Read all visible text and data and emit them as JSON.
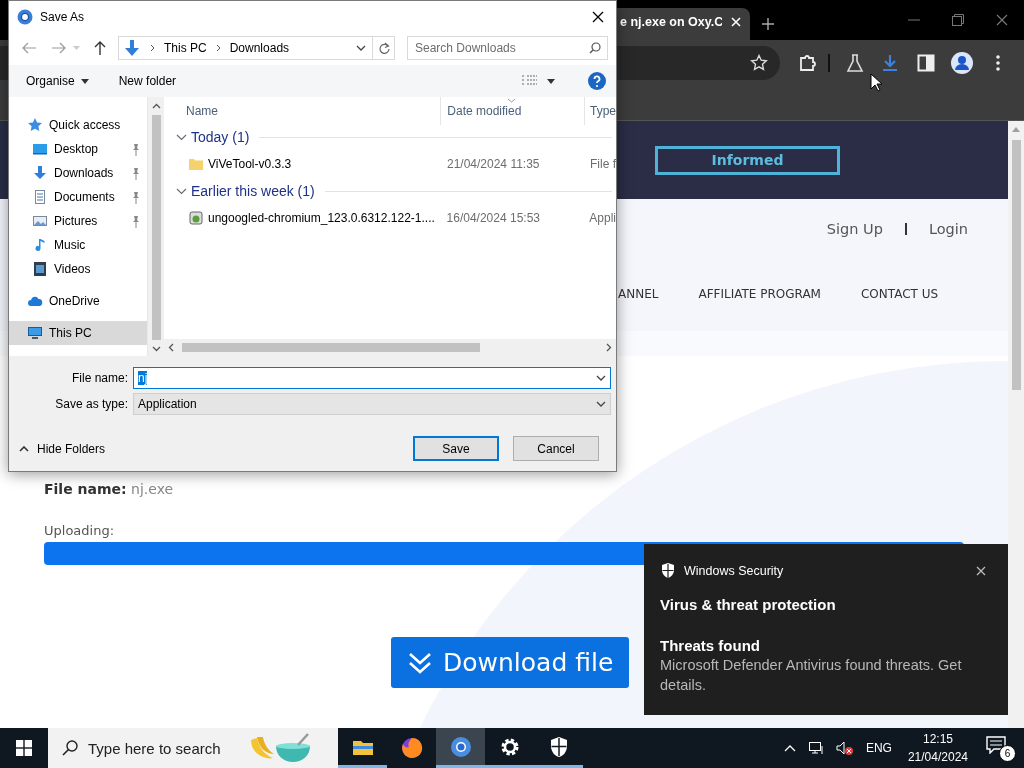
{
  "browser": {
    "tab_title": "e nj.exe on Oxy.C"
  },
  "page": {
    "header_button": "Informed",
    "auth_links": [
      "Sign Up",
      "Login"
    ],
    "nav": [
      "ANNEL",
      "AFFILIATE PROGRAM",
      "CONTACT US"
    ],
    "file_label": "File name:",
    "file_value": "nj.exe",
    "upload_label": "Uploading:",
    "upload": {
      "level": 1
    },
    "download_button": "Download file"
  },
  "dialog": {
    "title": "Save As",
    "path": [
      "This PC",
      "Downloads"
    ],
    "search": {
      "placeholder": "Search Downloads"
    },
    "toolbar": [
      {
        "label": "Organise",
        "kind": "menu"
      },
      {
        "label": "New folder",
        "kind": "button"
      }
    ],
    "nav_items": [
      {
        "label": "Quick access",
        "kind": "star",
        "selected": false,
        "children": [
          {
            "label": "Desktop",
            "kind": "desktop",
            "pinned": true,
            "selected": false
          },
          {
            "label": "Downloads",
            "kind": "download",
            "pinned": true,
            "selected": false
          },
          {
            "label": "Documents",
            "kind": "document",
            "pinned": true,
            "selected": false
          },
          {
            "label": "Pictures",
            "kind": "picture",
            "pinned": true,
            "selected": false
          },
          {
            "label": "Music",
            "kind": "music",
            "pinned": false,
            "selected": false
          },
          {
            "label": "Videos",
            "kind": "video",
            "pinned": false,
            "selected": false
          }
        ]
      },
      {
        "label": "OneDrive",
        "kind": "cloud",
        "selected": false
      },
      {
        "label": "This PC",
        "kind": "computer",
        "selected": true
      }
    ],
    "columns": [
      "Name",
      "Date modified",
      "Type"
    ],
    "groups": [
      {
        "label": "Today (1)",
        "files": [
          {
            "name": "ViVeTool-v0.3.3",
            "date": "21/04/2024 11:35",
            "type": "File f",
            "kind": "folder"
          }
        ]
      },
      {
        "label": "Earlier this week (1)",
        "files": [
          {
            "name": "ungoogled-chromium_123.0.6312.122-1....",
            "date": "16/04/2024 15:53",
            "type": "Appli",
            "kind": "app"
          }
        ]
      }
    ],
    "file_name_label": "File name:",
    "file_name": "nj",
    "save_type_label": "Save as type:",
    "save_type": "Application",
    "hide_folders": "Hide Folders",
    "buttons": [
      {
        "label": "Save",
        "default": true
      },
      {
        "label": "Cancel",
        "default": false
      }
    ]
  },
  "notification": {
    "app": "Windows Security",
    "title": "Virus & threat protection",
    "heading": "Threats found",
    "body": "Microsoft Defender Antivirus found threats. Get details."
  },
  "taskbar": {
    "search": {
      "placeholder": "Type here to search"
    },
    "apps": [
      {
        "kind": "explorer",
        "running": true,
        "selected": false
      },
      {
        "kind": "firefox",
        "running": false,
        "selected": false
      },
      {
        "kind": "chrome",
        "running": true,
        "selected": true
      },
      {
        "kind": "settings",
        "running": true,
        "selected": false
      },
      {
        "kind": "security",
        "running": true,
        "selected": false
      }
    ],
    "language": "ENG",
    "time": "12:15",
    "date": "21/04/2024",
    "notifications": "6"
  }
}
